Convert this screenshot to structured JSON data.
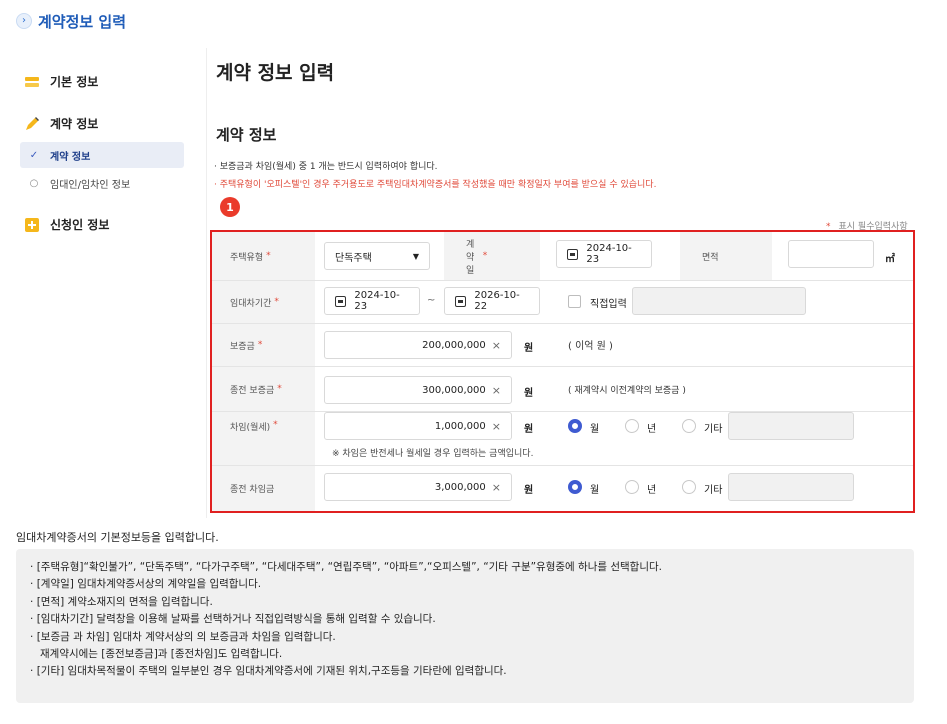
{
  "header": {
    "title": "계약정보 입력"
  },
  "sidebar": {
    "groups": [
      {
        "label": "기본 정보"
      },
      {
        "label": "계약 정보"
      },
      {
        "label": "신청인 정보"
      }
    ],
    "subitems": [
      {
        "label": "계약 정보",
        "active": true
      },
      {
        "label": "임대인/임차인 정보",
        "active": false
      }
    ]
  },
  "main": {
    "page_title": "계약 정보 입력",
    "section_title": "계약 정보",
    "notes": [
      "· 보증금과 차임(월세) 중 1 개는 반드시 입력하여야 합니다.",
      "· 주택유형이 '오피스텔'인 경우 주거용도로 주택임대차계약증서를 작성했을 때만 확정일자 부여를 받으실 수 있습니다."
    ],
    "step_badge": "1",
    "required_legend": "표시 필수입력사항",
    "required_star": "*"
  },
  "form": {
    "req_mark": "*",
    "house_type": {
      "label": "주택유형",
      "value": "단독주택"
    },
    "contract_date": {
      "label": "계약일",
      "value": "2024-10-23"
    },
    "area": {
      "label": "면적",
      "value": "",
      "unit": "㎡"
    },
    "lease_period": {
      "label": "임대차기간",
      "start": "2024-10-23",
      "separator": "~",
      "end": "2026-10-22",
      "direct_label": "직접입력"
    },
    "deposit": {
      "label": "보증금",
      "value": "200,000,000",
      "unit": "원",
      "hint": "( 이억 원 )"
    },
    "prev_deposit": {
      "label": "종전 보증금",
      "value": "300,000,000",
      "unit": "원",
      "hint": "( 재계약시 이전계약의 보증금 )"
    },
    "rent": {
      "label": "차임(월세)",
      "value": "1,000,000",
      "unit": "원",
      "options": [
        "월",
        "년",
        "기타"
      ],
      "selected": "월",
      "note": "※ 차임은 반전세나 월세일 경우 입력하는 금액입니다."
    },
    "prev_rent": {
      "label": "종전 차임금",
      "value": "3,000,000",
      "unit": "원",
      "options": [
        "월",
        "년",
        "기타"
      ],
      "selected": "월"
    },
    "clear_icon": "×"
  },
  "description": {
    "heading": "임대차계약증서의 기본정보등을 입력합니다.",
    "items": [
      "[주택유형]“확인불가”, “단독주택”, “다가구주택”, “다세대주택”, “연립주택”, “아파트”,“오피스텔”, “기타 구분”유형중에 하나를 선택합니다.",
      "[계약일] 임대차계약증서상의 계약일을 입력합니다.",
      "[면적] 계약소재지의 면적을 입력합니다.",
      "[임대차기간] 달력창을 이용해 날짜를 선택하거나 직접입력방식을 통해 입력할 수 있습니다.",
      "[보증금 과 차임] 임대차 계약서상의 의 보증금과 차임을 입력합니다.",
      "재계약시에는 [종전보증금]과 [종전차임]도 입력합니다.",
      "[기타] 임대차목적물이 주택의 일부분인 경우 임대차계약증서에 기재된 위치,구조등을 기타란에 입력합니다."
    ]
  },
  "colors": {
    "accent": "#1f5cb8",
    "required": "#e04a3a",
    "highlight_border": "#e02020",
    "radio_on": "#3f5bd1"
  }
}
